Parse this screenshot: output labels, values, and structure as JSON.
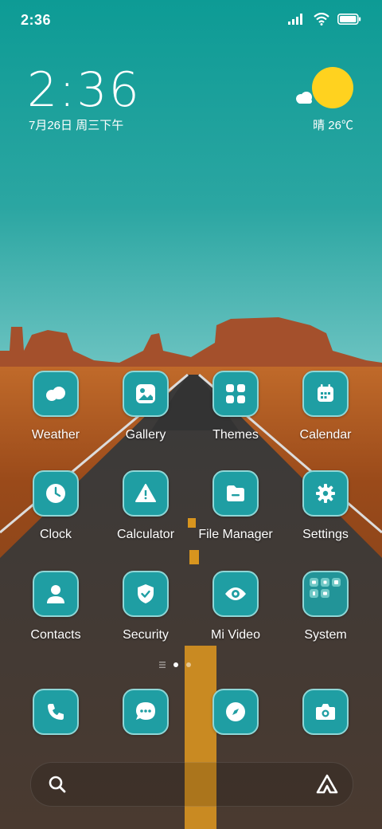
{
  "status_bar": {
    "time": "2:36",
    "icons": [
      "signal-icon",
      "wifi-icon",
      "battery-icon"
    ]
  },
  "clock_widget": {
    "time": "2:36",
    "date": "7月26日 周三下午"
  },
  "weather_widget": {
    "text": "晴 26℃",
    "icon": "sunny-cloud-icon"
  },
  "apps": [
    {
      "label": "Weather",
      "icon": "weather-cloud-icon"
    },
    {
      "label": "Gallery",
      "icon": "gallery-icon"
    },
    {
      "label": "Themes",
      "icon": "themes-grid-icon"
    },
    {
      "label": "Calendar",
      "icon": "calendar-icon"
    },
    {
      "label": "Clock",
      "icon": "clock-icon"
    },
    {
      "label": "Calculator",
      "icon": "warning-triangle-icon"
    },
    {
      "label": "File Manager",
      "icon": "folder-icon"
    },
    {
      "label": "Settings",
      "icon": "gear-icon"
    },
    {
      "label": "Contacts",
      "icon": "person-icon"
    },
    {
      "label": "Security",
      "icon": "shield-check-icon"
    },
    {
      "label": "Mi Video",
      "icon": "eye-icon"
    },
    {
      "label": "System",
      "icon": "folder-grid-icon"
    }
  ],
  "page_indicator": {
    "pages": 2,
    "current": 1
  },
  "dock": [
    {
      "icon": "phone-icon"
    },
    {
      "icon": "message-icon"
    },
    {
      "icon": "compass-icon"
    },
    {
      "icon": "camera-icon"
    }
  ],
  "search_bar": {
    "icons": [
      "search-icon",
      "assistant-icon"
    ]
  },
  "colors": {
    "icon_bg": "#1f9ea3",
    "icon_border": "#8fd6d6",
    "sky_top": "#0d9b95",
    "sun": "#ffd21f"
  }
}
